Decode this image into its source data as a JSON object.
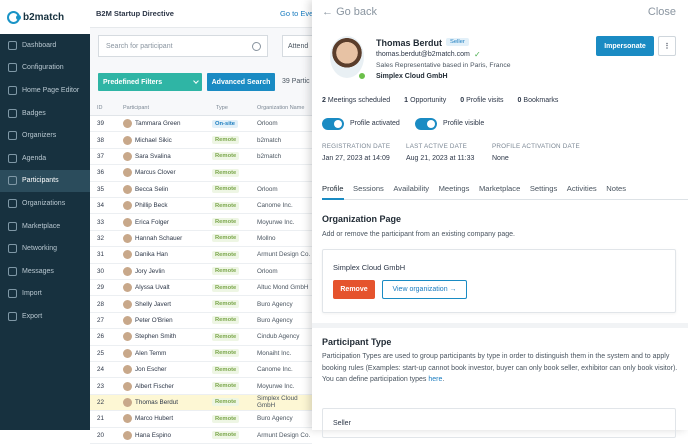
{
  "brand": {
    "name": "b2match"
  },
  "sidebar": {
    "items": [
      "Dashboard",
      "Configuration",
      "Home Page Editor",
      "Badges",
      "Organizers",
      "Agenda",
      "Participants",
      "Organizations",
      "Marketplace",
      "Networking",
      "Messages",
      "Import",
      "Export"
    ],
    "active": "Participants"
  },
  "header": {
    "event": "B2M Startup Directive",
    "goto": "Go to Eve"
  },
  "list": {
    "search_placeholder": "Search for participant",
    "attend_label": "Attend",
    "filters_label": "Predefined Filters",
    "advanced_label": "Advanced Search",
    "count": "39 Partic",
    "columns": {
      "id": "ID",
      "participant": "Participant",
      "type": "Type",
      "org": "Organization Name"
    },
    "rows": [
      {
        "id": "39",
        "name": "Tammara Green",
        "type": "On-site",
        "org": "Orloom"
      },
      {
        "id": "38",
        "name": "Michael Sikic",
        "type": "Remote",
        "org": "b2match"
      },
      {
        "id": "37",
        "name": "Sara Svalina",
        "type": "Remote",
        "org": "b2match"
      },
      {
        "id": "36",
        "name": "Marcus Clover",
        "type": "Remote",
        "org": ""
      },
      {
        "id": "35",
        "name": "Becca Selin",
        "type": "Remote",
        "org": "Orloom"
      },
      {
        "id": "34",
        "name": "Phillip Beck",
        "type": "Remote",
        "org": "Canome Inc."
      },
      {
        "id": "33",
        "name": "Erica Folger",
        "type": "Remote",
        "org": "Moyurwe Inc."
      },
      {
        "id": "32",
        "name": "Hannah Schauer",
        "type": "Remote",
        "org": "Mollno"
      },
      {
        "id": "31",
        "name": "Danika Han",
        "type": "Remote",
        "org": "Armunt Design Co."
      },
      {
        "id": "30",
        "name": "Jory Jevlin",
        "type": "Remote",
        "org": "Orloom"
      },
      {
        "id": "29",
        "name": "Alyssa Uvalt",
        "type": "Remote",
        "org": "Altuc Mond GmbH"
      },
      {
        "id": "28",
        "name": "Shelly Javert",
        "type": "Remote",
        "org": "Buro Agency"
      },
      {
        "id": "27",
        "name": "Peter O'Brien",
        "type": "Remote",
        "org": "Buro Agency"
      },
      {
        "id": "26",
        "name": "Stephen Smith",
        "type": "Remote",
        "org": "Cindub Agency"
      },
      {
        "id": "25",
        "name": "Alen Temm",
        "type": "Remote",
        "org": "Monaiht Inc."
      },
      {
        "id": "24",
        "name": "Jon Escher",
        "type": "Remote",
        "org": "Canome Inc."
      },
      {
        "id": "23",
        "name": "Albert Fischer",
        "type": "Remote",
        "org": "Moyurwe Inc."
      },
      {
        "id": "22",
        "name": "Thomas Berdut",
        "type": "Remote",
        "org": "Simplex Cloud GmbH"
      },
      {
        "id": "21",
        "name": "Marco Hubert",
        "type": "Remote",
        "org": "Buro Agency"
      },
      {
        "id": "20",
        "name": "Hana Espino",
        "type": "Remote",
        "org": "Armunt Design Co."
      }
    ],
    "highlight": "22"
  },
  "panel": {
    "back": "Go back",
    "close": "Close",
    "name": "Thomas Berdut",
    "badge": "Seller",
    "email": "thomas.berdut@b2match.com",
    "check": "✓",
    "title": "Sales Representative based in Paris, France",
    "company": "Simplex Cloud GmbH",
    "impersonate": "Impersonate",
    "more": "⋮",
    "stats": [
      {
        "n": "2",
        "l": "Meetings scheduled"
      },
      {
        "n": "1",
        "l": "Opportunity"
      },
      {
        "n": "0",
        "l": "Profile visits"
      },
      {
        "n": "0",
        "l": "Bookmarks"
      }
    ],
    "toggle1": "Profile activated",
    "toggle2": "Profile visible",
    "dates": [
      {
        "l": "REGISTRATION DATE",
        "v": "Jan 27, 2023 at 14:09"
      },
      {
        "l": "LAST ACTIVE DATE",
        "v": "Aug 21, 2023 at 11:33"
      },
      {
        "l": "PROFILE ACTIVATION DATE",
        "v": "None"
      }
    ],
    "tabs": [
      "Profile",
      "Sessions",
      "Availability",
      "Meetings",
      "Marketplace",
      "Settings",
      "Activities",
      "Notes"
    ],
    "org_heading": "Organization Page",
    "org_desc": "Add or remove the participant from an existing company page.",
    "org_name": "Simplex Cloud GmbH",
    "remove": "Remove",
    "view_org": "View organization →",
    "pt_heading": "Participant Type",
    "pt_desc": "Participation Types are used to group participants by type in order to distinguish them in the system and to apply booking rules (Examples: start-up cannot book investor, buyer can only book seller, exhibitor can only book visitor). You can define participation types ",
    "pt_link": "here",
    "pt_period": ".",
    "pt_value": "Seller"
  },
  "colors": {
    "accent": "#1a8bc3",
    "teal": "#2fb5a5",
    "danger": "#e5532d",
    "sidebar": "#17313f"
  }
}
